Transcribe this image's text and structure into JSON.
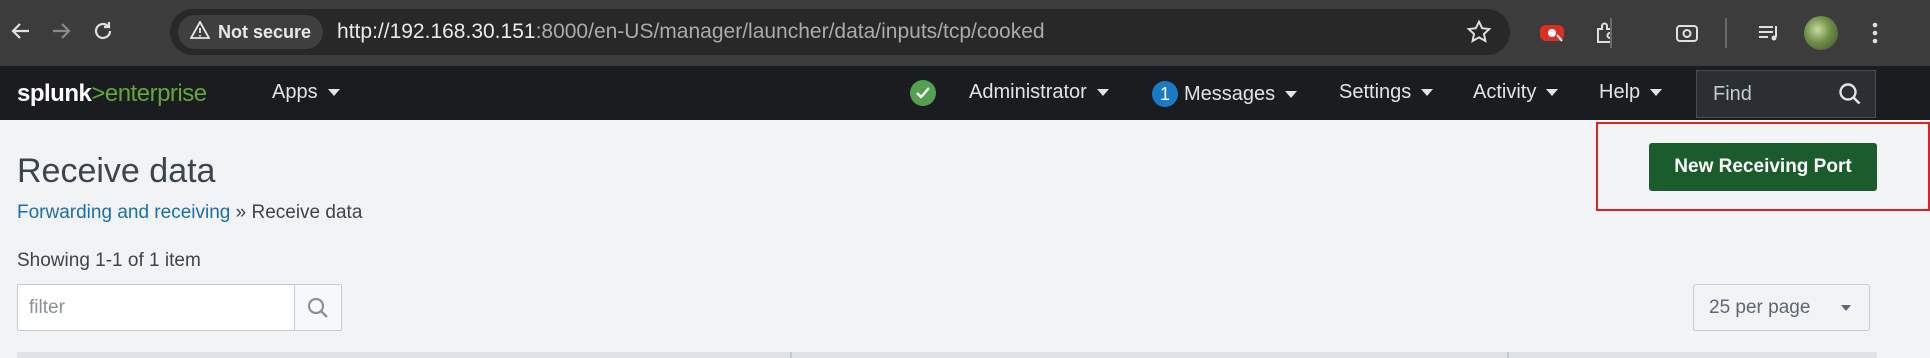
{
  "browser": {
    "security_label": "Not secure",
    "url_host": "http://192.168.30.151",
    "url_rest": ":8000/en-US/manager/launcher/data/inputs/tcp/cooked"
  },
  "splunkbar": {
    "logo_brand": "splunk",
    "logo_sep": ">",
    "logo_product": "enterprise",
    "apps_label": "Apps",
    "user_label": "Administrator",
    "messages_count": "1",
    "messages_label": "Messages",
    "settings_label": "Settings",
    "activity_label": "Activity",
    "help_label": "Help",
    "find_placeholder": "Find"
  },
  "page": {
    "title": "Receive data",
    "breadcrumb_link": "Forwarding and receiving",
    "breadcrumb_sep": "»",
    "breadcrumb_current": "Receive data",
    "showing": "Showing 1-1 of 1 item",
    "filter_placeholder": "filter",
    "per_page": "25 per page",
    "new_button": "New Receiving Port"
  },
  "colors": {
    "accent_green": "#65a637",
    "button_green": "#1a5c2b",
    "link_blue": "#1a6fa8",
    "highlight_red": "#e02020"
  }
}
